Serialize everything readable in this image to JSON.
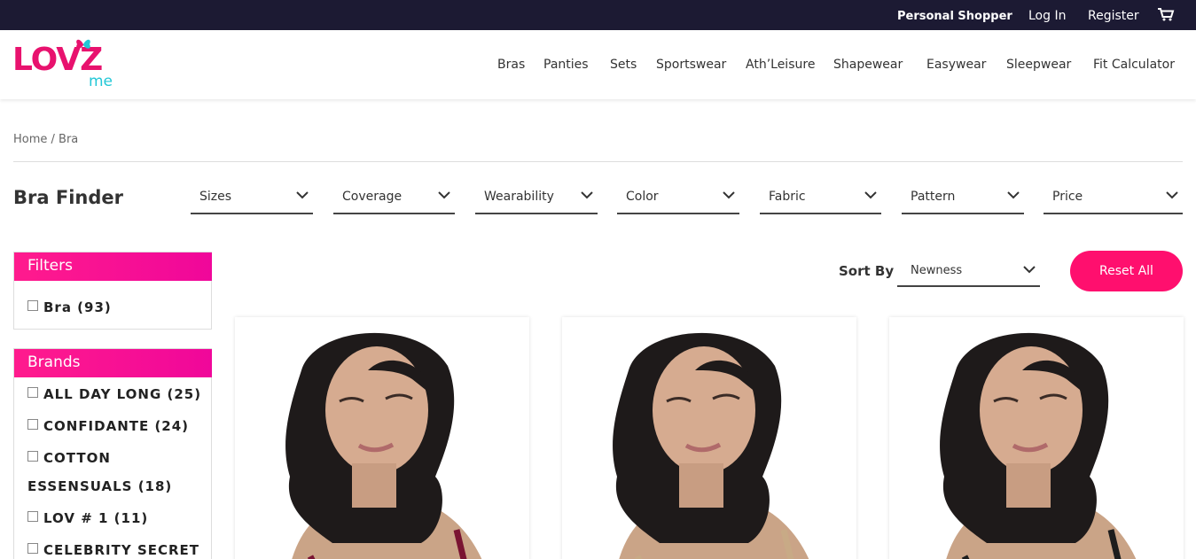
{
  "topbar": {
    "personal_shopper": "Personal Shopper",
    "login": "Log In",
    "register": "Register",
    "cart_icon": "cart-icon"
  },
  "header": {
    "logo_main": "LOVZ",
    "logo_sub": "me",
    "nav": [
      "Bras",
      "Panties",
      "Sets",
      "Sportswear",
      "Ath’Leisure",
      "Shapewear",
      "Easywear",
      "Sleepwear",
      "Fit Calculator"
    ]
  },
  "breadcrumb": "Home / Bra",
  "finder": {
    "title": "Bra Finder",
    "selects": [
      "Sizes",
      "Coverage",
      "Wearability",
      "Color",
      "Fabric",
      "Pattern",
      "Price"
    ]
  },
  "filters": {
    "title": "Filters",
    "items": [
      "Bra (93)"
    ]
  },
  "brands": {
    "title": "Brands",
    "items": [
      "ALL DAY LONG (25)",
      "CONFIDANTE (24)",
      "COTTON",
      "ESSENSUALS (18)",
      "LOV # 1 (11)",
      "CELEBRITY SECRET"
    ]
  },
  "sort": {
    "label": "Sort By",
    "value": "Newness",
    "reset": "Reset All"
  },
  "colors": {
    "topbar": "#1c1a33",
    "accent": "#ff0f6e",
    "logo_pink": "#e8126e",
    "logo_cyan": "#22c7d6"
  },
  "products": [
    {
      "strap_color": "#7a1432"
    },
    {
      "strap_color": "#c8aa86"
    },
    {
      "strap_color": "#1d1d1d"
    }
  ]
}
